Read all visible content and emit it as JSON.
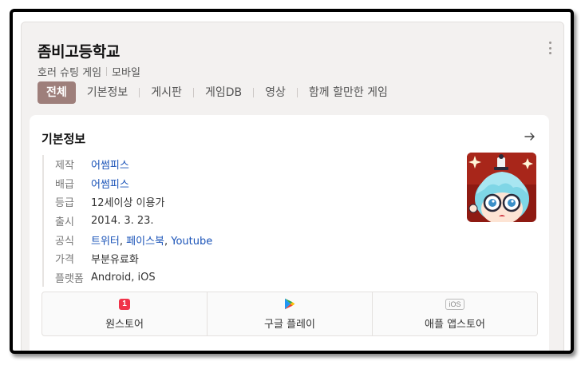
{
  "header": {
    "title": "좀비고등학교",
    "genre": "호러 슈팅 게임",
    "platform": "모바일"
  },
  "tabs": [
    {
      "label": "전체",
      "active": true
    },
    {
      "label": "기본정보",
      "active": false
    },
    {
      "label": "게시판",
      "active": false
    },
    {
      "label": "게임DB",
      "active": false
    },
    {
      "label": "영상",
      "active": false
    },
    {
      "label": "함께 할만한 게임",
      "active": false
    }
  ],
  "basic_info": {
    "section_title": "기본정보",
    "rows": [
      {
        "key": "제작",
        "value": "어썸피스"
      },
      {
        "key": "배급",
        "value": "어썸피스"
      },
      {
        "key": "등급",
        "value": "12세이상 이용가"
      },
      {
        "key": "출시",
        "value": "2014. 3. 23."
      },
      {
        "key": "공식",
        "links": [
          "트위터",
          "페이스북",
          "Youtube"
        ]
      },
      {
        "key": "가격",
        "value": "부분유료화"
      },
      {
        "key": "플랫폼",
        "value": "Android, iOS"
      }
    ]
  },
  "stores": [
    {
      "label": "원스토어",
      "icon": "onestore-icon",
      "icon_text": "1"
    },
    {
      "label": "구글 플레이",
      "icon": "google-play-icon"
    },
    {
      "label": "애플 앱스토어",
      "icon": "app-store-icon",
      "icon_text": "iOS"
    }
  ],
  "colors": {
    "active_tab": "#9e7f7b",
    "link": "#1a53b8",
    "onestore": "#f0334a"
  }
}
